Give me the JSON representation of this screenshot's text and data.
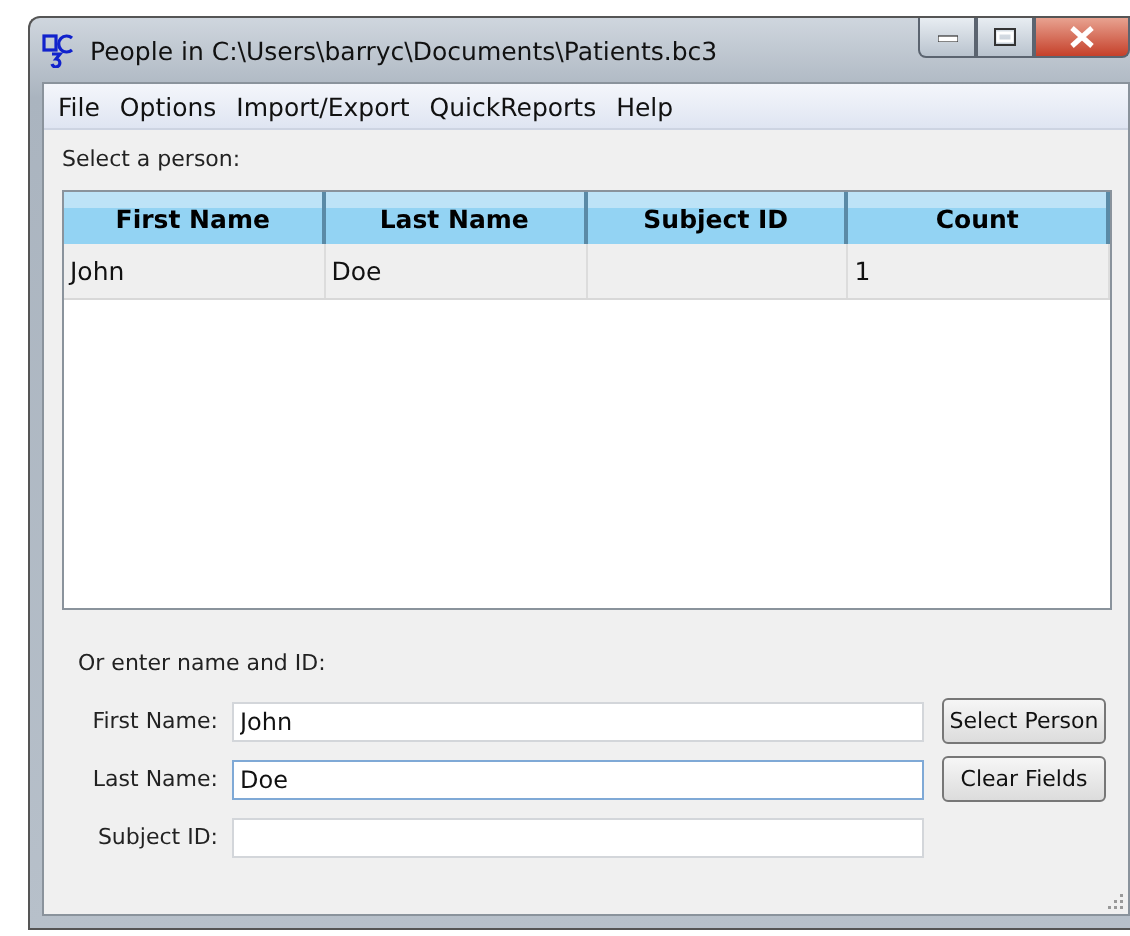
{
  "window": {
    "title": "People in C:\\Users\\barryc\\Documents\\Patients.bc3"
  },
  "menu": [
    "File",
    "Options",
    "Import/Export",
    "QuickReports",
    "Help"
  ],
  "table": {
    "caption": "Select a person:",
    "columns": [
      "First Name",
      "Last Name",
      "Subject ID",
      "Count"
    ],
    "rows": [
      [
        "John",
        "Doe",
        null,
        "1"
      ]
    ]
  },
  "form": {
    "caption": "Or enter name and ID:",
    "fields": [
      {
        "label": "First Name:",
        "value": "John",
        "focused": false
      },
      {
        "label": "Last Name:",
        "value": "Doe",
        "focused": true
      },
      {
        "label": "Subject ID:",
        "focused": false
      }
    ],
    "buttons": [
      "Select Person",
      "Clear Fields"
    ]
  }
}
